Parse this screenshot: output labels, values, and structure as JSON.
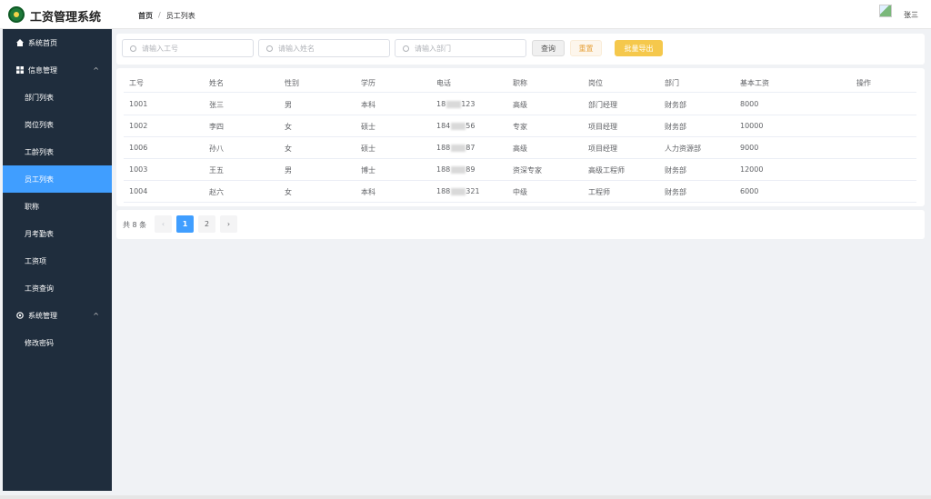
{
  "app": {
    "title": "工资管理系统"
  },
  "breadcrumb": {
    "home": "首页",
    "separator": "/",
    "current": "员工列表"
  },
  "user": {
    "name": "张三"
  },
  "sidebar": {
    "items": [
      {
        "label": "系统首页",
        "icon": "home-icon"
      },
      {
        "label": "信息管理",
        "icon": "grid-icon",
        "expanded": true
      },
      {
        "label": "部门列表"
      },
      {
        "label": "岗位列表"
      },
      {
        "label": "工龄列表"
      },
      {
        "label": "员工列表",
        "active": true
      },
      {
        "label": "职称"
      },
      {
        "label": "月考勤表"
      },
      {
        "label": "工资项"
      },
      {
        "label": "工资查询"
      },
      {
        "label": "系统管理",
        "icon": "gear-icon",
        "expanded": true
      },
      {
        "label": "修改密码"
      }
    ],
    "active_color": "#409eff",
    "bg_color": "#1f2d3d"
  },
  "search": {
    "employee_id_placeholder": "请输入工号",
    "name_placeholder": "请输入姓名",
    "department_placeholder": "请输入部门",
    "query_label": "查询",
    "reset_label": "重置",
    "export_label": "批量导出"
  },
  "table": {
    "columns": [
      "工号",
      "姓名",
      "性别",
      "学历",
      "电话",
      "职称",
      "岗位",
      "部门",
      "基本工资",
      "操作"
    ],
    "rows": [
      {
        "id": "1001",
        "name": "张三",
        "gender": "男",
        "education": "本科",
        "phone_prefix": "18",
        "phone_suffix": "123",
        "title": "高级",
        "post": "部门经理",
        "dept": "财务部",
        "salary": "8000"
      },
      {
        "id": "1002",
        "name": "李四",
        "gender": "女",
        "education": "硕士",
        "phone_prefix": "184",
        "phone_suffix": "56",
        "title": "专家",
        "post": "项目经理",
        "dept": "财务部",
        "salary": "10000"
      },
      {
        "id": "1006",
        "name": "孙八",
        "gender": "女",
        "education": "硕士",
        "phone_prefix": "188",
        "phone_suffix": "87",
        "title": "高级",
        "post": "项目经理",
        "dept": "人力资源部",
        "salary": "9000"
      },
      {
        "id": "1003",
        "name": "王五",
        "gender": "男",
        "education": "博士",
        "phone_prefix": "188",
        "phone_suffix": "89",
        "title": "资深专家",
        "post": "高级工程师",
        "dept": "财务部",
        "salary": "12000"
      },
      {
        "id": "1004",
        "name": "赵六",
        "gender": "女",
        "education": "本科",
        "phone_prefix": "188",
        "phone_suffix": "321",
        "title": "中级",
        "post": "工程师",
        "dept": "财务部",
        "salary": "6000"
      }
    ]
  },
  "pagination": {
    "total_text": "共 8 条",
    "prev": "‹",
    "next": "›",
    "pages": [
      "1",
      "2"
    ],
    "current": "1"
  }
}
